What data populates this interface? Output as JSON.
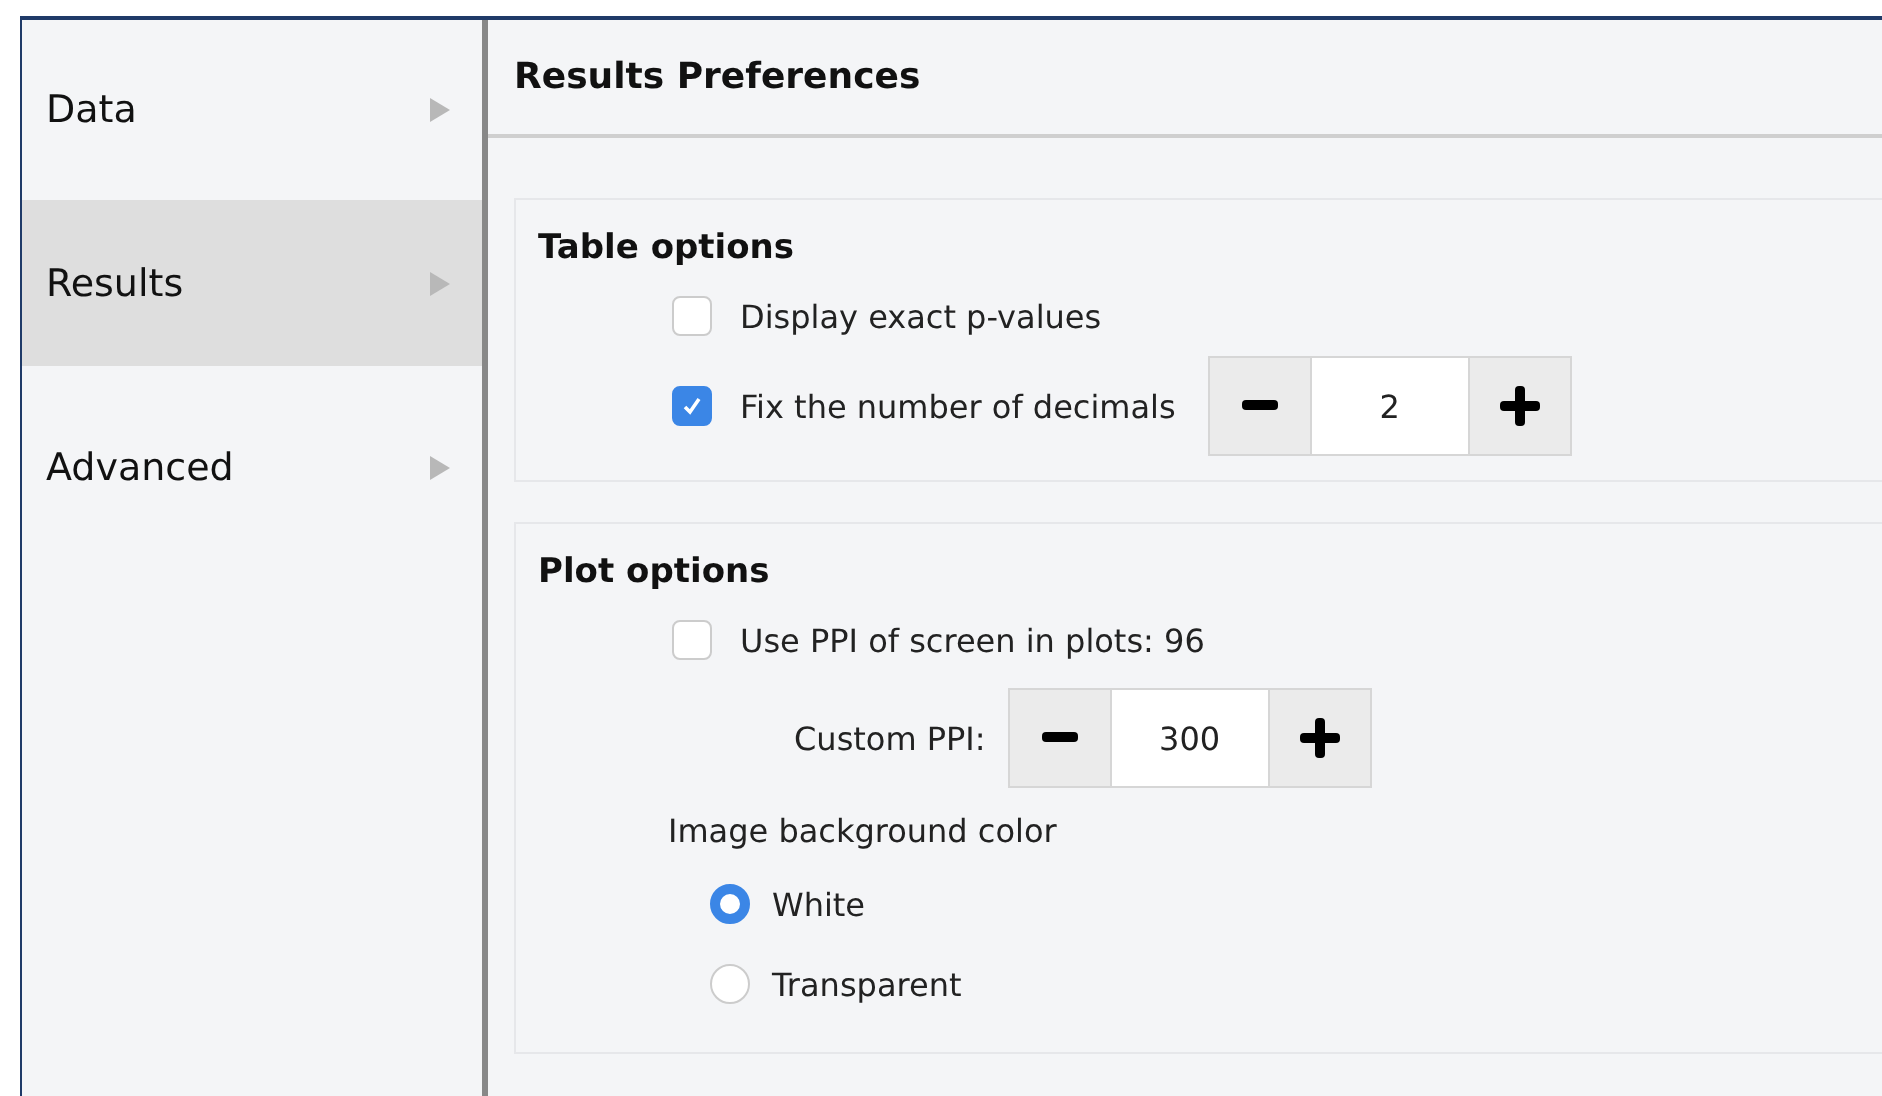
{
  "sidebar": {
    "items": [
      {
        "label": "Data",
        "selected": false
      },
      {
        "label": "Results",
        "selected": true
      },
      {
        "label": "Advanced",
        "selected": false
      }
    ]
  },
  "header": {
    "title": "Results Preferences"
  },
  "sections": [
    {
      "title": "Table options",
      "rows": [
        {
          "kind": "checkbox",
          "label": "Display exact p-values",
          "checked": false
        },
        {
          "kind": "checkbox",
          "label": "Fix the number of decimals",
          "checked": true,
          "spin_value": "2"
        }
      ]
    },
    {
      "title": "Plot options",
      "rows": [
        {
          "kind": "checkbox",
          "label": "Use PPI of screen in plots: 96",
          "checked": false
        },
        {
          "kind": "spin",
          "label": "Custom PPI:",
          "spin_value": "300"
        },
        {
          "kind": "text",
          "label": "Image background color"
        },
        {
          "kind": "radio",
          "label": "White",
          "selected": true
        },
        {
          "kind": "radio",
          "label": "Transparent",
          "selected": false
        }
      ]
    }
  ]
}
